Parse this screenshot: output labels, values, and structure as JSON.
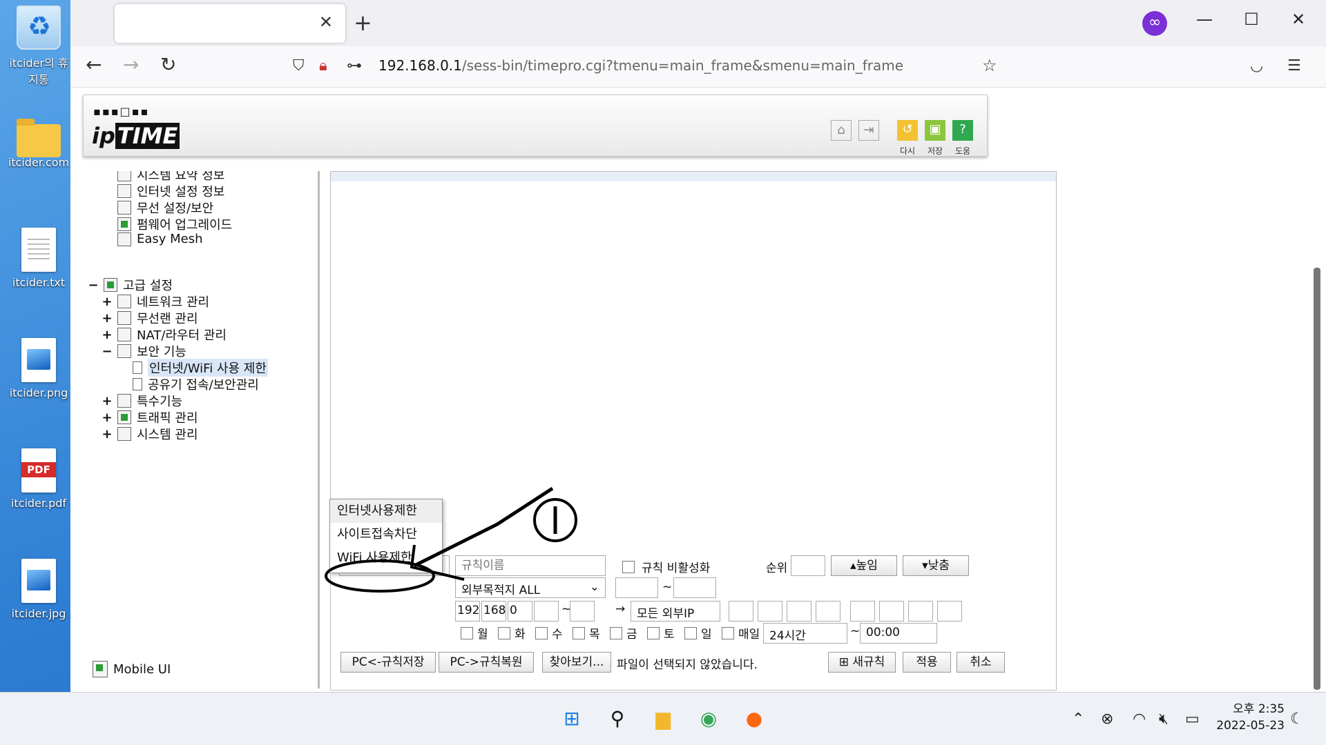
{
  "desktop": {
    "icons": [
      {
        "label": "itcider의 휴지통",
        "icon": "recycle-bin-icon"
      },
      {
        "label": "itcider.com",
        "icon": "folder-icon"
      },
      {
        "label": "itcider.txt",
        "icon": "text-file-icon"
      },
      {
        "label": "itcider.png",
        "icon": "image-file-icon"
      },
      {
        "label": "itcider.pdf",
        "icon": "pdf-file-icon"
      },
      {
        "label": "itcider.jpg",
        "icon": "image-file-icon"
      }
    ]
  },
  "browser": {
    "tab_close": "✕",
    "new_tab": "+",
    "url_host": "192.168.0.1",
    "url_path": "/sess-bin/timepro.cgi?tmenu=main_frame&smenu=main_frame"
  },
  "iptime": {
    "logo_top": "▪▪▪□▪▪",
    "logo_ip": "ip",
    "logo_time": "TIME",
    "toolbar": {
      "reload": "다시",
      "save": "저장",
      "help": "도움"
    }
  },
  "sidebar": {
    "items": [
      {
        "label": "시스템 요약 정보"
      },
      {
        "label": "인터넷 설정 정보"
      },
      {
        "label": "무선 설정/보안"
      },
      {
        "label": "펌웨어 업그레이드"
      },
      {
        "label": "Easy Mesh"
      }
    ],
    "advanced": {
      "label": "고급 설정",
      "toggle": "−",
      "children": [
        {
          "label": "네트워크 관리",
          "toggle": "+"
        },
        {
          "label": "무선랜 관리",
          "toggle": "+"
        },
        {
          "label": "NAT/라우터 관리",
          "toggle": "+"
        },
        {
          "label": "보안 기능",
          "toggle": "−"
        },
        {
          "label": "특수기능",
          "toggle": "+"
        },
        {
          "label": "트래픽 관리",
          "toggle": "+"
        },
        {
          "label": "시스템 관리",
          "toggle": "+"
        }
      ],
      "security_children": [
        {
          "label": "인터넷/WiFi 사용 제한",
          "selected": true
        },
        {
          "label": "공유기 접속/보안관리"
        }
      ]
    },
    "mobile_ui": "Mobile UI"
  },
  "form": {
    "rule_type_value": "인터넷사용제한",
    "rule_name_placeholder": "규칙이름",
    "disable_rule_label": "규칙 비활성화",
    "priority_label": "순위",
    "raise_button": "▴높임",
    "lower_button": "▾낮춤",
    "dest_select": "외부목적지 ALL",
    "tilde": "~",
    "ip": [
      "192",
      "168",
      "0",
      ""
    ],
    "arrow": "→",
    "all_external_ip": "모든 외부IP",
    "days": [
      "월",
      "화",
      "수",
      "목",
      "금",
      "토",
      "일"
    ],
    "everyday": "매일",
    "time_select": "24시간",
    "time_start": "00:00",
    "dropdown_options": [
      "인터넷사용제한",
      "사이트접속차단",
      "WiFi 사용제한"
    ],
    "save_to_pc": "PC<-규칙저장",
    "restore_from_pc": "PC->규칙복원",
    "browse": "찾아보기...",
    "no_file": "파일이 선택되지 않았습니다.",
    "new_rule": "새규칙",
    "apply": "적용",
    "cancel": "취소"
  },
  "annotation": {
    "label": "①"
  },
  "taskbar": {
    "clock_time": "오후 2:35",
    "clock_date": "2022-05-23"
  }
}
